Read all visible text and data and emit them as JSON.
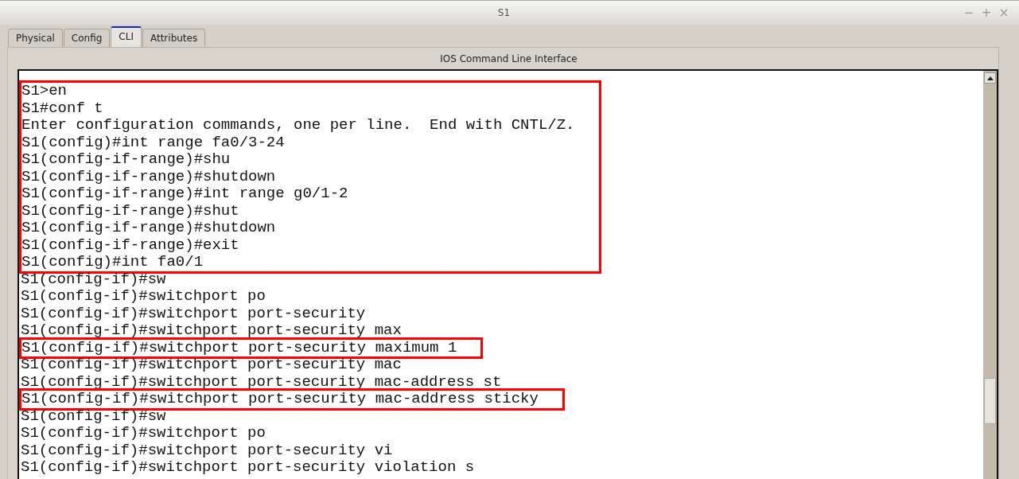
{
  "window": {
    "title": "S1",
    "controls": [
      "−",
      "+",
      "×"
    ]
  },
  "tabs": [
    {
      "label": "Physical",
      "selected": false
    },
    {
      "label": "Config",
      "selected": false
    },
    {
      "label": "CLI",
      "selected": true
    },
    {
      "label": "Attributes",
      "selected": false
    }
  ],
  "panel_title": "IOS Command Line Interface",
  "console": {
    "blocks": [
      {
        "highlighted": true,
        "lines": [
          "S1>en",
          "S1#conf t",
          "Enter configuration commands, one per line.  End with CNTL/Z.",
          "S1(config)#int range fa0/3-24",
          "S1(config-if-range)#shu",
          "S1(config-if-range)#shutdown",
          "S1(config-if-range)#int range g0/1-2",
          "S1(config-if-range)#shut",
          "S1(config-if-range)#shutdown",
          "S1(config-if-range)#exit",
          "S1(config)#int fa0/1"
        ]
      },
      {
        "highlighted": false,
        "lines": [
          "S1(config-if)#sw",
          "S1(config-if)#switchport po",
          "S1(config-if)#switchport port-security",
          "S1(config-if)#switchport port-security max"
        ]
      },
      {
        "highlighted": true,
        "lines": [
          "S1(config-if)#switchport port-security maximum 1"
        ]
      },
      {
        "highlighted": false,
        "lines": [
          "S1(config-if)#switchport port-security mac",
          "S1(config-if)#switchport port-security mac-address st"
        ]
      },
      {
        "highlighted": true,
        "lines": [
          "S1(config-if)#switchport port-security mac-address sticky"
        ]
      },
      {
        "highlighted": false,
        "lines": [
          "S1(config-if)#sw",
          "S1(config-if)#switchport po",
          "S1(config-if)#switchport port-security vi",
          "S1(config-if)#switchport port-security violation s"
        ]
      }
    ]
  }
}
